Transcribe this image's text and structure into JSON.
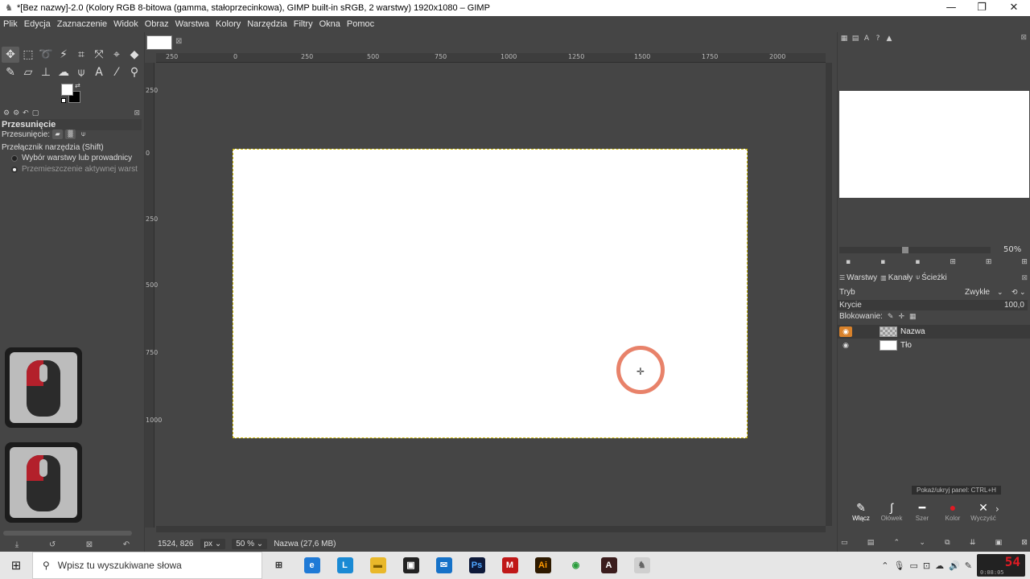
{
  "window": {
    "title": "*[Bez nazwy]-2.0 (Kolory RGB 8-bitowa (gamma, stałoprzecinkowa), GIMP built-in sRGB, 2 warstwy) 1920x1080 – GIMP",
    "minimize": "—",
    "maximize": "❐",
    "close": "✕"
  },
  "menu": [
    "Plik",
    "Edycja",
    "Zaznaczenie",
    "Widok",
    "Obraz",
    "Warstwa",
    "Kolory",
    "Narzędzia",
    "Filtry",
    "Okna",
    "Pomoc"
  ],
  "toolbox": {
    "tools_row1": [
      "move",
      "rect-select",
      "lasso",
      "fuzzy-select",
      "crop",
      "transform",
      "warp",
      "bucket"
    ],
    "tools_row2": [
      "paintbrush",
      "eraser",
      "clone",
      "smudge",
      "paths",
      "text",
      "color-picker",
      "zoom"
    ],
    "options_title": "Przesunięcie",
    "move_label": "Przesunięcie:",
    "switch_label": "Przełącznik narzędzia  (Shift)",
    "radio1": "Wybór warstwy lub prowadnicy",
    "radio2": "Przemieszczenie aktywnej warst"
  },
  "canvas": {
    "ruler_h": [
      "250",
      "0",
      "250",
      "500",
      "750",
      "1000",
      "1250",
      "1500",
      "1750",
      "2000"
    ],
    "ruler_v": [
      "250",
      "0",
      "250",
      "500",
      "750",
      "1000"
    ],
    "tab_close": "⊠"
  },
  "status": {
    "coords": "1524, 826",
    "unit": "px",
    "zoom": "50 %",
    "layer_info": "Nazwa (27,6 MB)"
  },
  "navigator": {
    "zoom": "50%"
  },
  "layers": {
    "tabs": [
      "Warstwy",
      "Kanały",
      "Ścieżki"
    ],
    "mode_label": "Tryb",
    "mode_value": "Zwykłe",
    "opacity_label": "Krycie",
    "opacity_value": "100,0",
    "lock_label": "Blokowanie:",
    "items": [
      {
        "name": "Nazwa",
        "selected": true
      },
      {
        "name": "Tło",
        "selected": false
      }
    ]
  },
  "annotation": {
    "tip": "Pokaż/ukryj panel: CTRL+H",
    "buttons": [
      {
        "label": "Włącz"
      },
      {
        "label": "Ołówek"
      },
      {
        "label": "Szer"
      },
      {
        "label": "Kolor"
      },
      {
        "label": "Wyczyść"
      }
    ]
  },
  "taskbar": {
    "search_placeholder": "Wpisz tu wyszukiwane słowa",
    "apps": [
      {
        "name": "task-view",
        "glyph": "⊞",
        "color": "#e6e6e6",
        "text_color": "#333"
      },
      {
        "name": "edge",
        "glyph": "e",
        "color": "#1f7ad6",
        "text_color": "#fff"
      },
      {
        "name": "lumion",
        "glyph": "L",
        "color": "#1a8ad4",
        "text_color": "#fff"
      },
      {
        "name": "file-explorer",
        "glyph": "▬",
        "color": "#e9b82a",
        "text_color": "#7a5a00"
      },
      {
        "name": "store",
        "glyph": "▣",
        "color": "#222222",
        "text_color": "#fff"
      },
      {
        "name": "mail",
        "glyph": "✉",
        "color": "#1672c8",
        "text_color": "#fff"
      },
      {
        "name": "photoshop",
        "glyph": "Ps",
        "color": "#0e1a3a",
        "text_color": "#4fa6ff"
      },
      {
        "name": "mcafee",
        "glyph": "M",
        "color": "#c01818",
        "text_color": "#fff"
      },
      {
        "name": "illustrator",
        "glyph": "Ai",
        "color": "#2e1a00",
        "text_color": "#ff9a00"
      },
      {
        "name": "chrome",
        "glyph": "◉",
        "color": "#e6e6e6",
        "text_color": "#2a9d3c"
      },
      {
        "name": "autocad",
        "glyph": "A",
        "color": "#3b1d1d",
        "text_color": "#fff"
      },
      {
        "name": "gimp",
        "glyph": "♞",
        "color": "#cfcfcf",
        "text_color": "#666"
      }
    ],
    "clock_big": "54",
    "clock_small": "0:08:05"
  }
}
